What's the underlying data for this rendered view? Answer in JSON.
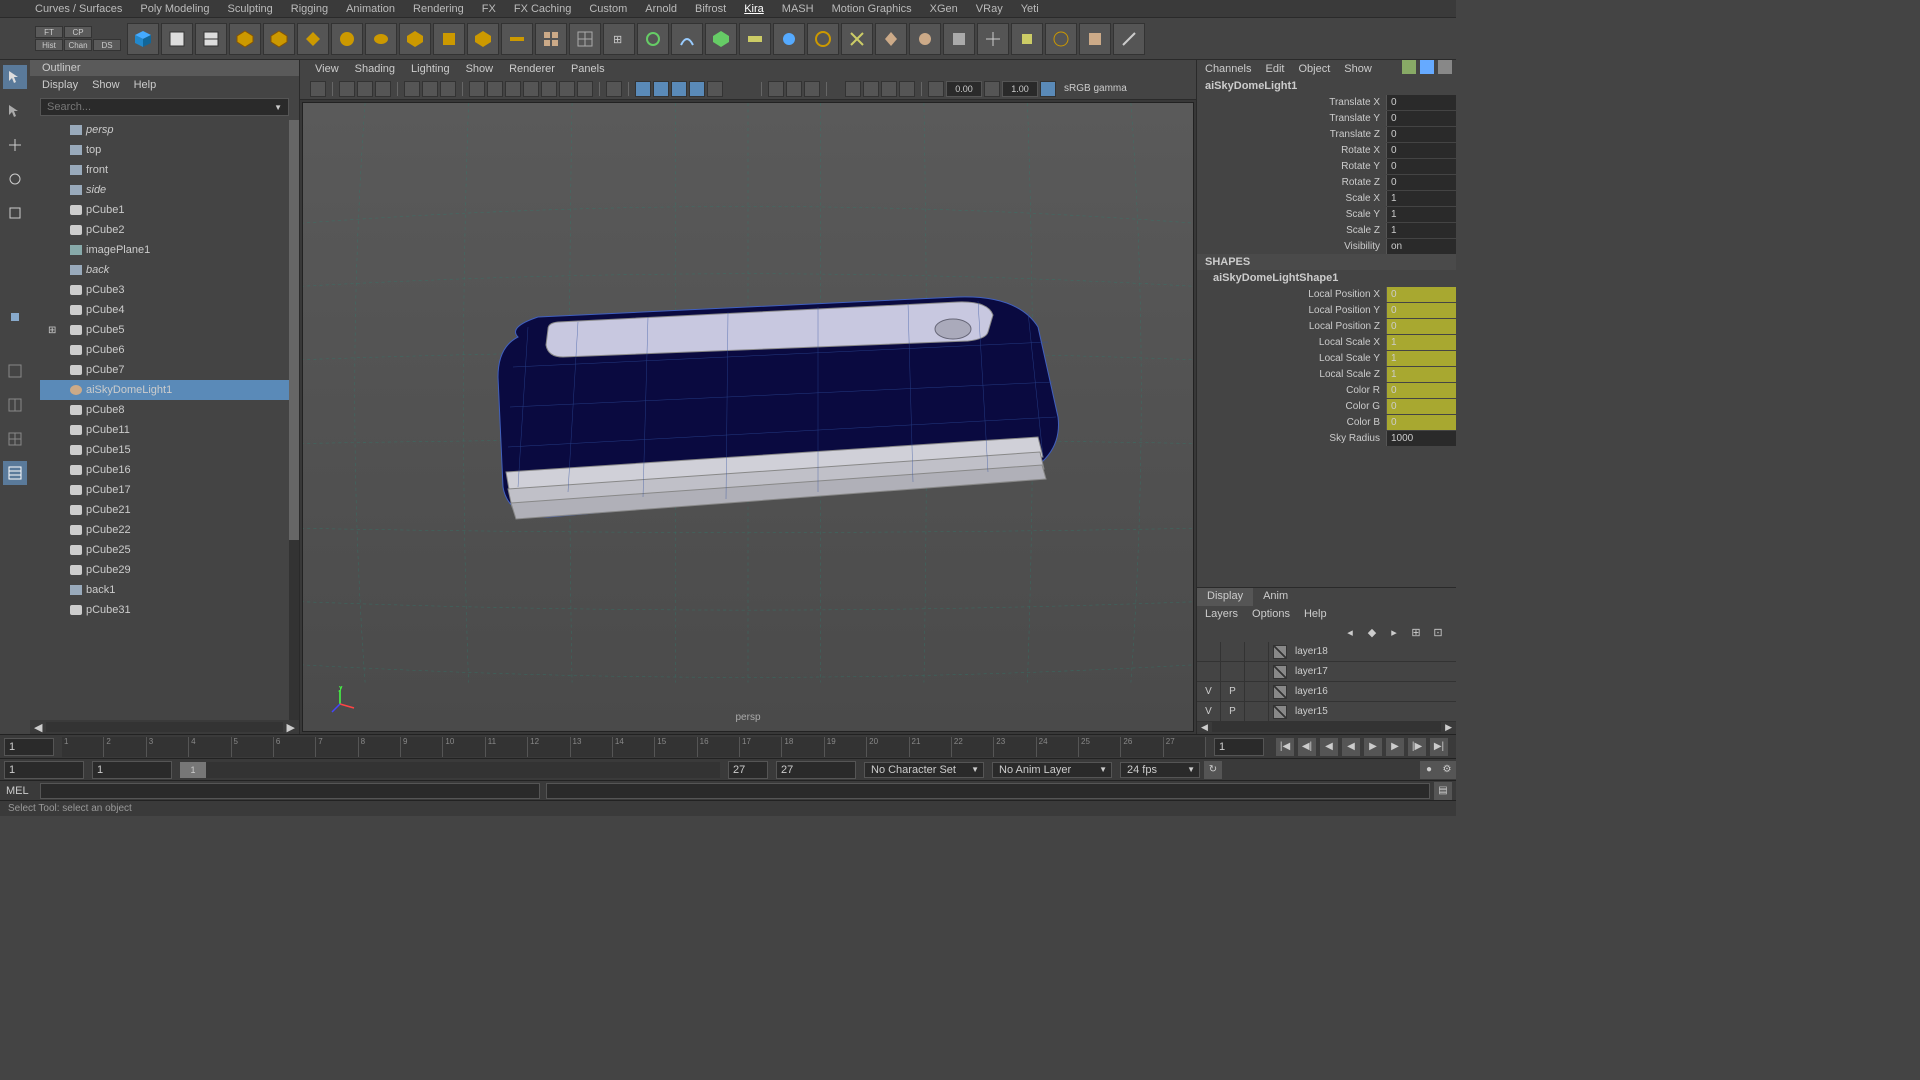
{
  "shelf_tabs": [
    "Curves / Surfaces",
    "Poly Modeling",
    "Sculpting",
    "Rigging",
    "Animation",
    "Rendering",
    "FX",
    "FX Caching",
    "Custom",
    "Arnold",
    "Bifrost",
    "Kira",
    "MASH",
    "Motion Graphics",
    "XGen",
    "VRay",
    "Yeti"
  ],
  "shelf_active": "Kira",
  "status_buttons": [
    "FT",
    "CP",
    "Hist",
    "Chan",
    "DS"
  ],
  "outliner": {
    "title": "Outliner",
    "menus": [
      "Display",
      "Show",
      "Help"
    ],
    "search_placeholder": "Search...",
    "items": [
      {
        "name": "persp",
        "type": "cam",
        "dim": true
      },
      {
        "name": "top",
        "type": "cam"
      },
      {
        "name": "front",
        "type": "cam"
      },
      {
        "name": "side",
        "type": "cam",
        "dim": true
      },
      {
        "name": "pCube1",
        "type": "mesh"
      },
      {
        "name": "pCube2",
        "type": "mesh"
      },
      {
        "name": "imagePlane1",
        "type": "img"
      },
      {
        "name": "back",
        "type": "cam",
        "dim": true
      },
      {
        "name": "pCube3",
        "type": "mesh"
      },
      {
        "name": "pCube4",
        "type": "mesh"
      },
      {
        "name": "pCube5",
        "type": "mesh",
        "expandable": true
      },
      {
        "name": "pCube6",
        "type": "mesh"
      },
      {
        "name": "pCube7",
        "type": "mesh"
      },
      {
        "name": "aiSkyDomeLight1",
        "type": "light",
        "selected": true
      },
      {
        "name": "pCube8",
        "type": "mesh"
      },
      {
        "name": "pCube11",
        "type": "mesh"
      },
      {
        "name": "pCube15",
        "type": "mesh"
      },
      {
        "name": "pCube16",
        "type": "mesh"
      },
      {
        "name": "pCube17",
        "type": "mesh"
      },
      {
        "name": "pCube21",
        "type": "mesh"
      },
      {
        "name": "pCube22",
        "type": "mesh"
      },
      {
        "name": "pCube25",
        "type": "mesh"
      },
      {
        "name": "pCube29",
        "type": "mesh"
      },
      {
        "name": "back1",
        "type": "cam"
      },
      {
        "name": "pCube31",
        "type": "mesh"
      }
    ]
  },
  "viewport": {
    "menus": [
      "View",
      "Shading",
      "Lighting",
      "Show",
      "Renderer",
      "Panels"
    ],
    "exposure": "0.00",
    "gamma": "1.00",
    "colorspace": "sRGB gamma",
    "camera": "persp"
  },
  "channel_box": {
    "tabs": [
      "Channels",
      "Edit",
      "Object",
      "Show"
    ],
    "node": "aiSkyDomeLight1",
    "transform_attrs": [
      {
        "label": "Translate X",
        "value": "0"
      },
      {
        "label": "Translate Y",
        "value": "0"
      },
      {
        "label": "Translate Z",
        "value": "0"
      },
      {
        "label": "Rotate X",
        "value": "0"
      },
      {
        "label": "Rotate Y",
        "value": "0"
      },
      {
        "label": "Rotate Z",
        "value": "0"
      },
      {
        "label": "Scale X",
        "value": "1"
      },
      {
        "label": "Scale Y",
        "value": "1"
      },
      {
        "label": "Scale Z",
        "value": "1"
      },
      {
        "label": "Visibility",
        "value": "on"
      }
    ],
    "shapes_label": "SHAPES",
    "shape_node": "aiSkyDomeLightShape1",
    "shape_attrs": [
      {
        "label": "Local Position X",
        "value": "0",
        "color": true
      },
      {
        "label": "Local Position Y",
        "value": "0",
        "color": true
      },
      {
        "label": "Local Position Z",
        "value": "0",
        "color": true
      },
      {
        "label": "Local Scale X",
        "value": "1",
        "color": true
      },
      {
        "label": "Local Scale Y",
        "value": "1",
        "color": true
      },
      {
        "label": "Local Scale Z",
        "value": "1",
        "color": true
      },
      {
        "label": "Color R",
        "value": "0",
        "color": true
      },
      {
        "label": "Color G",
        "value": "0",
        "color": true
      },
      {
        "label": "Color B",
        "value": "0",
        "color": true
      },
      {
        "label": "Sky Radius",
        "value": "1000"
      }
    ]
  },
  "layer_editor": {
    "tabs": [
      "Display",
      "Anim"
    ],
    "menus": [
      "Layers",
      "Options",
      "Help"
    ],
    "layers": [
      {
        "v": "",
        "p": "",
        "name": "layer18"
      },
      {
        "v": "",
        "p": "",
        "name": "layer17"
      },
      {
        "v": "V",
        "p": "P",
        "name": "layer16"
      },
      {
        "v": "V",
        "p": "P",
        "name": "layer15"
      }
    ]
  },
  "timeline": {
    "ticks": [
      "1",
      "2",
      "3",
      "4",
      "5",
      "6",
      "7",
      "8",
      "9",
      "10",
      "11",
      "12",
      "13",
      "14",
      "15",
      "16",
      "17",
      "18",
      "19",
      "20",
      "21",
      "22",
      "23",
      "24",
      "25",
      "26",
      "27"
    ],
    "current": "1",
    "end_field": "1"
  },
  "range": {
    "start": "1",
    "inner_start": "1",
    "inner_end": "27",
    "end": "27",
    "thumb": "1",
    "charset": "No Character Set",
    "animlayer": "No Anim Layer",
    "fps": "24 fps"
  },
  "cmdline": {
    "label": "MEL"
  },
  "helpline": "Select Tool: select an object"
}
